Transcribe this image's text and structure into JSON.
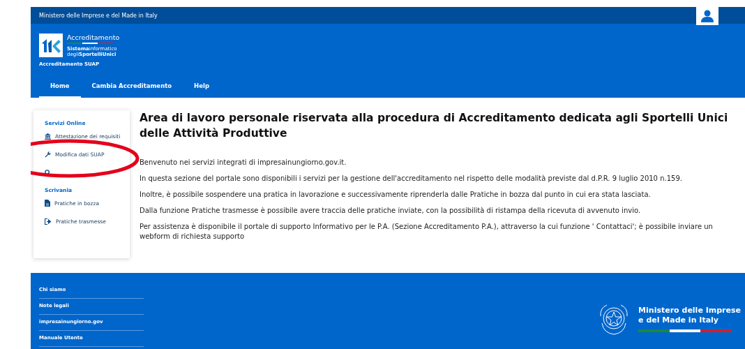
{
  "top_bar": {
    "title": "Ministero delle Imprese e del Made in Italy"
  },
  "header": {
    "logo_title": "Accreditamento",
    "logo_line1": "**Sistema**informatico",
    "logo_line2": "degli**SportelliUnici**",
    "subtitle": "Accreditamento SUAP"
  },
  "nav": [
    {
      "label": "Home",
      "selected": true
    },
    {
      "label": "Cambia Accreditamento",
      "selected": false
    },
    {
      "label": "Help",
      "selected": false
    }
  ],
  "sidebar": {
    "sections": [
      {
        "title": "Servizi Online",
        "items": [
          {
            "label": "Attestazione dei requisiti",
            "kind": "bank"
          },
          {
            "label": "Modifica dati SUAP",
            "kind": "wrench"
          },
          {
            "kind": "search"
          }
        ]
      },
      {
        "title": "Scrivania",
        "items": [
          {
            "label": "Pratiche in bozza",
            "kind": "file"
          },
          {
            "label": "Pratiche trasmesse",
            "kind": "exit"
          }
        ]
      }
    ]
  },
  "main": {
    "heading": "Area di lavoro personale riservata alla procedura di Accreditamento dedicata agli Sportelli Unici delle Attività Produttive",
    "paragraphs": [
      "Benvenuto nei servizi integrati di impresainungiorno.gov.it.",
      "In questa sezione del portale sono disponibili i servizi per la gestione dell'accreditamento nel rispetto delle modalità previste dal d.P.R. 9 luglio 2010 n.159.",
      "Inoltre, è possibile sospendere una pratica in lavorazione e successivamente riprenderla dalle Pratiche in bozza dal punto in cui era stata lasciata.",
      "Dalla funzione Pratiche trasmesse è possibile avere traccia delle pratiche inviate, con la possibilità di ristampa della ricevuta di avvenuto invio.",
      "Per assistenza è disponibile  il portale di supporto Informativo per le P.A. (Sezione Accreditamento P.A.), attraverso la cui funzione ' Contattaci'; è possibile inviare un webform di richiesta supporto"
    ]
  },
  "footer": {
    "links": [
      "Chi siamo",
      "Note legali",
      "impresainungiorno.gov",
      "Manuale Utente"
    ],
    "ministry": "Ministero delle Imprese\ne del Made in Italy"
  }
}
